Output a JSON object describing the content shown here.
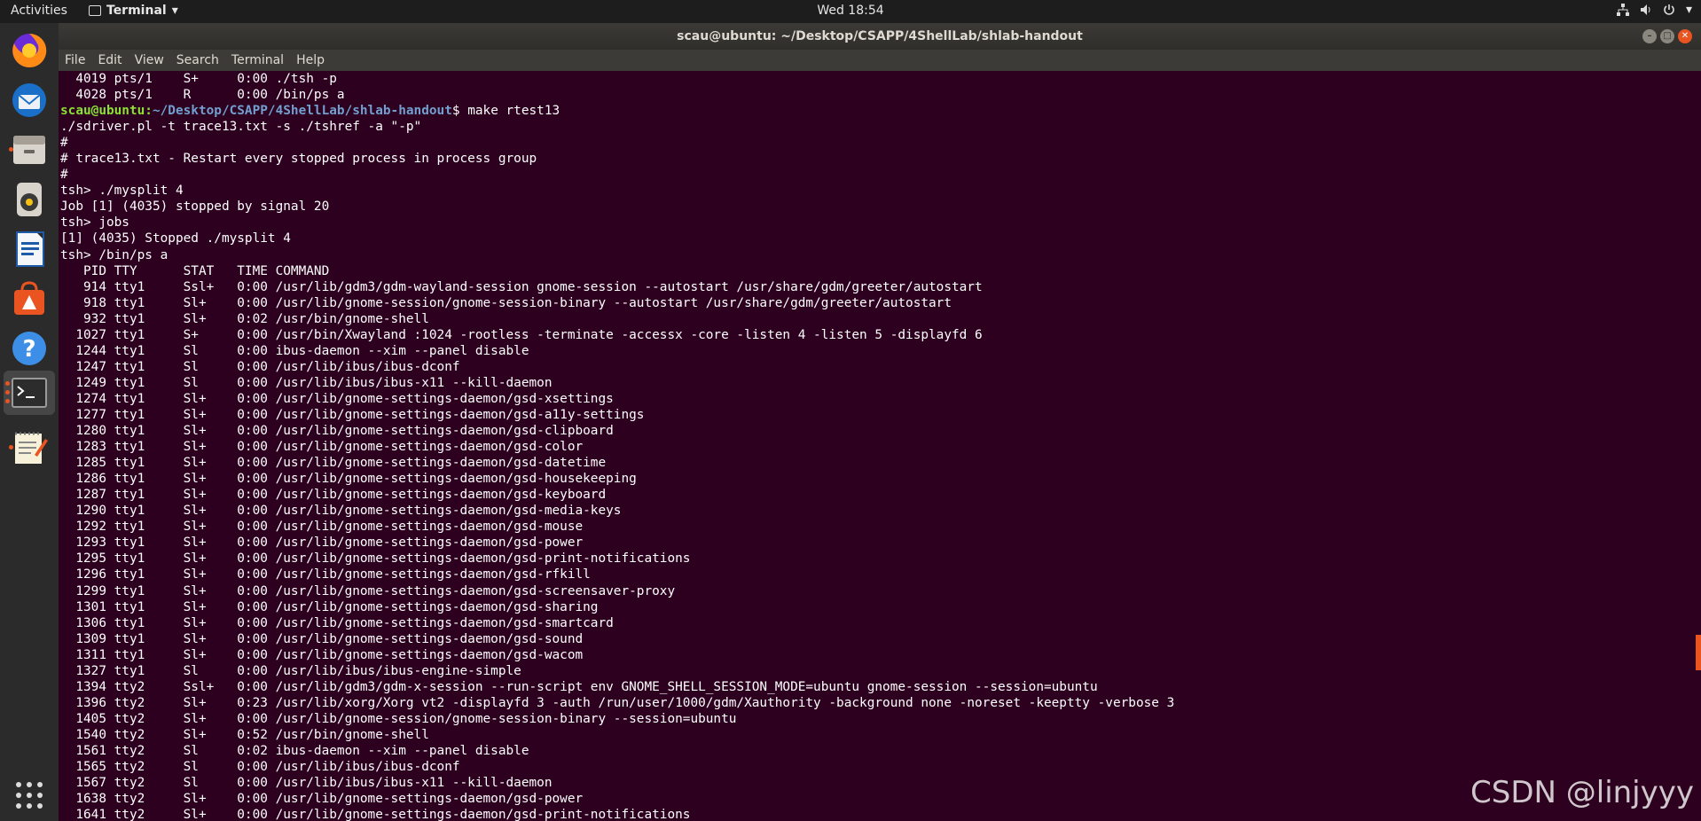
{
  "topbar": {
    "activities": "Activities",
    "app_name": "Terminal",
    "app_icon": "terminal-icon",
    "clock": "Wed 18:54",
    "tray_icons": [
      "network-icon",
      "volume-icon",
      "power-icon",
      "chevron-down-icon"
    ]
  },
  "dock": {
    "items": [
      {
        "name": "firefox-icon",
        "running": false
      },
      {
        "name": "thunderbird-icon",
        "running": false
      },
      {
        "name": "files-icon",
        "running": true
      },
      {
        "name": "rhythmbox-icon",
        "running": false
      },
      {
        "name": "libreoffice-writer-icon",
        "running": false
      },
      {
        "name": "software-center-icon",
        "running": false
      },
      {
        "name": "help-icon",
        "running": false
      },
      {
        "name": "terminal-icon",
        "running": true,
        "active": true
      },
      {
        "name": "text-editor-icon",
        "running": true
      },
      {
        "name": "show-applications-icon",
        "running": false
      }
    ]
  },
  "window": {
    "title": "scau@ubuntu: ~/Desktop/CSAPP/4ShellLab/shlab-handout",
    "menu": [
      "File",
      "Edit",
      "View",
      "Search",
      "Terminal",
      "Help"
    ]
  },
  "terminal": {
    "prompt_user": "scau@ubuntu",
    "prompt_path": "~/Desktop/CSAPP/4ShellLab/shlab-handout",
    "lines": [
      "  4019 pts/1    S+     0:00 ./tsh -p",
      "  4028 pts/1    R      0:00 /bin/ps a",
      "{{PROMPT}}$ make rtest13",
      "./sdriver.pl -t trace13.txt -s ./tshref -a \"-p\"",
      "#",
      "# trace13.txt - Restart every stopped process in process group",
      "#",
      "tsh> ./mysplit 4",
      "Job [1] (4035) stopped by signal 20",
      "tsh> jobs",
      "[1] (4035) Stopped ./mysplit 4",
      "tsh> /bin/ps a",
      "   PID TTY      STAT   TIME COMMAND",
      "   914 tty1     Ssl+   0:00 /usr/lib/gdm3/gdm-wayland-session gnome-session --autostart /usr/share/gdm/greeter/autostart",
      "   918 tty1     Sl+    0:00 /usr/lib/gnome-session/gnome-session-binary --autostart /usr/share/gdm/greeter/autostart",
      "   932 tty1     Sl+    0:02 /usr/bin/gnome-shell",
      "  1027 tty1     S+     0:00 /usr/bin/Xwayland :1024 -rootless -terminate -accessx -core -listen 4 -listen 5 -displayfd 6",
      "  1244 tty1     Sl     0:00 ibus-daemon --xim --panel disable",
      "  1247 tty1     Sl     0:00 /usr/lib/ibus/ibus-dconf",
      "  1249 tty1     Sl     0:00 /usr/lib/ibus/ibus-x11 --kill-daemon",
      "  1274 tty1     Sl+    0:00 /usr/lib/gnome-settings-daemon/gsd-xsettings",
      "  1277 tty1     Sl+    0:00 /usr/lib/gnome-settings-daemon/gsd-a11y-settings",
      "  1280 tty1     Sl+    0:00 /usr/lib/gnome-settings-daemon/gsd-clipboard",
      "  1283 tty1     Sl+    0:00 /usr/lib/gnome-settings-daemon/gsd-color",
      "  1285 tty1     Sl+    0:00 /usr/lib/gnome-settings-daemon/gsd-datetime",
      "  1286 tty1     Sl+    0:00 /usr/lib/gnome-settings-daemon/gsd-housekeeping",
      "  1287 tty1     Sl+    0:00 /usr/lib/gnome-settings-daemon/gsd-keyboard",
      "  1290 tty1     Sl+    0:00 /usr/lib/gnome-settings-daemon/gsd-media-keys",
      "  1292 tty1     Sl+    0:00 /usr/lib/gnome-settings-daemon/gsd-mouse",
      "  1293 tty1     Sl+    0:00 /usr/lib/gnome-settings-daemon/gsd-power",
      "  1295 tty1     Sl+    0:00 /usr/lib/gnome-settings-daemon/gsd-print-notifications",
      "  1296 tty1     Sl+    0:00 /usr/lib/gnome-settings-daemon/gsd-rfkill",
      "  1299 tty1     Sl+    0:00 /usr/lib/gnome-settings-daemon/gsd-screensaver-proxy",
      "  1301 tty1     Sl+    0:00 /usr/lib/gnome-settings-daemon/gsd-sharing",
      "  1306 tty1     Sl+    0:00 /usr/lib/gnome-settings-daemon/gsd-smartcard",
      "  1309 tty1     Sl+    0:00 /usr/lib/gnome-settings-daemon/gsd-sound",
      "  1311 tty1     Sl+    0:00 /usr/lib/gnome-settings-daemon/gsd-wacom",
      "  1327 tty1     Sl     0:00 /usr/lib/ibus/ibus-engine-simple",
      "  1394 tty2     Ssl+   0:00 /usr/lib/gdm3/gdm-x-session --run-script env GNOME_SHELL_SESSION_MODE=ubuntu gnome-session --session=ubuntu",
      "  1396 tty2     Sl+    0:23 /usr/lib/xorg/Xorg vt2 -displayfd 3 -auth /run/user/1000/gdm/Xauthority -background none -noreset -keeptty -verbose 3",
      "  1405 tty2     Sl+    0:00 /usr/lib/gnome-session/gnome-session-binary --session=ubuntu",
      "  1540 tty2     Sl+    0:52 /usr/bin/gnome-shell",
      "  1561 tty2     Sl     0:02 ibus-daemon --xim --panel disable",
      "  1565 tty2     Sl     0:00 /usr/lib/ibus/ibus-dconf",
      "  1567 tty2     Sl     0:00 /usr/lib/ibus/ibus-x11 --kill-daemon",
      "  1638 tty2     Sl+    0:00 /usr/lib/gnome-settings-daemon/gsd-power",
      "  1641 tty2     Sl+    0:00 /usr/lib/gnome-settings-daemon/gsd-print-notifications"
    ]
  },
  "watermark": "CSDN @linjyyy",
  "colors": {
    "terminal_bg": "#2c001e",
    "prompt_user": "#8ae234",
    "prompt_path": "#729fcf",
    "accent": "#e95420"
  }
}
